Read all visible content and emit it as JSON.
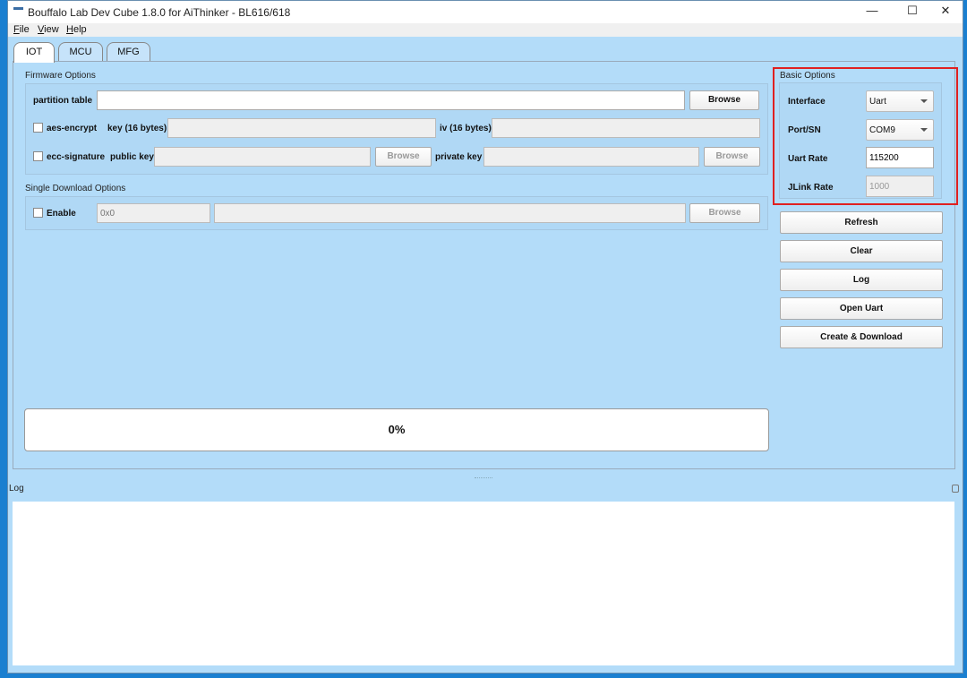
{
  "window": {
    "title": "Bouffalo Lab Dev Cube 1.8.0 for AiThinker - BL616/618",
    "minimize": "—",
    "maximize": "☐",
    "close": "✕"
  },
  "menu": [
    {
      "label": "File"
    },
    {
      "label": "View"
    },
    {
      "label": "Help"
    }
  ],
  "tabs": [
    {
      "label": "IOT",
      "active": true
    },
    {
      "label": "MCU"
    },
    {
      "label": "MFG"
    }
  ],
  "firmware": {
    "title": "Firmware Options",
    "partition_label": "partition table",
    "partition_value": "",
    "browse": "Browse",
    "aes_label": "aes-encrypt",
    "aes_checked": false,
    "key_label": "key (16 bytes)",
    "iv_label": "iv (16 bytes)",
    "ecc_label": "ecc-signature",
    "ecc_checked": false,
    "pubkey_label": "public key",
    "privkey_label": "private key"
  },
  "single": {
    "title": "Single Download Options",
    "enable_label": "Enable",
    "enable_checked": false,
    "address_placeholder": "0x0",
    "browse": "Browse"
  },
  "progress": {
    "value": 0,
    "text": "0%"
  },
  "basic": {
    "title": "Basic Options",
    "interface_label": "Interface",
    "interface_value": "Uart",
    "port_label": "Port/SN",
    "port_value": "COM9",
    "uart_rate_label": "Uart Rate",
    "uart_rate_value": "115200",
    "jlink_rate_label": "JLink Rate",
    "jlink_rate_value": "1000",
    "highlight_color": "#e02020"
  },
  "actions": [
    {
      "label": "Refresh"
    },
    {
      "label": "Clear"
    },
    {
      "label": "Log"
    },
    {
      "label": "Open Uart"
    },
    {
      "label": "Create & Download"
    }
  ],
  "log": {
    "title": "Log",
    "content": ""
  }
}
